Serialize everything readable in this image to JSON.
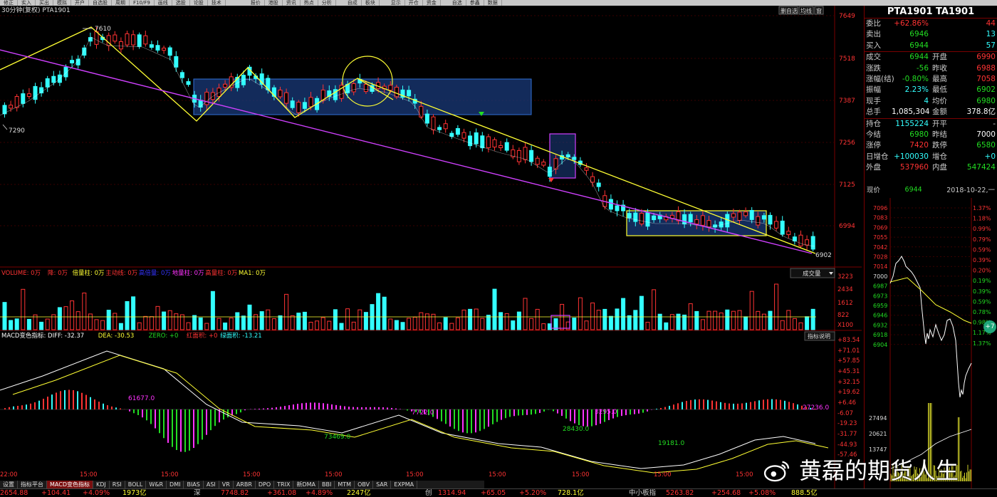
{
  "topbar": {
    "items": [
      "修正",
      "实入",
      "买出",
      "模拟",
      "开户",
      "自选股",
      "周期",
      "F10/F9",
      "画线",
      "选股",
      "论股",
      "技术",
      "",
      "报价",
      "港股",
      "资讯",
      "热点",
      "分析",
      "",
      "自成",
      "板块",
      "",
      "显示",
      "开仓",
      "资金",
      "",
      "自选",
      "参鑫",
      "数据"
    ],
    "active_index": 12
  },
  "chart": {
    "header_title": "30分钟(复权)  PTA1901",
    "header_buttons": [
      "删自选",
      "均线",
      "窗"
    ],
    "price_axis": [
      "7649",
      "7518",
      "7387",
      "7256",
      "7125",
      "6994"
    ],
    "high_label": "7610",
    "low_label": "7290",
    "last_label": "6902",
    "volume_header": [
      {
        "text": "VOLUME: 0万",
        "color": "#ff3333"
      },
      {
        "text": "降: 0万",
        "color": "#ff3333"
      },
      {
        "text": "倍量柱: 0万",
        "color": "#ffff33"
      },
      {
        "text": "主动线: 0万",
        "color": "#ff3333"
      },
      {
        "text": "高倍量: 0万",
        "color": "#3333ff"
      },
      {
        "text": "地量柱: 0万",
        "color": "#ff33ff"
      },
      {
        "text": "高量柱: 0万",
        "color": "#ff3333"
      },
      {
        "text": "MA1: 0万",
        "color": "#ffff33"
      }
    ],
    "volume_button": "成交量",
    "volume_axis": [
      "3223",
      "2434",
      "1612",
      "822",
      "X100"
    ],
    "macd_header": [
      {
        "text": "MACD变色指标: DIFF: -32.37",
        "color": "#ffffff"
      },
      {
        "text": "DEA: -30.53",
        "color": "#ffff33"
      },
      {
        "text": "ZERO: +0",
        "color": "#22dd22"
      },
      {
        "text": "红面积: +0",
        "color": "#ff3333"
      },
      {
        "text": "绿面积: -13.21",
        "color": "#33ffff"
      }
    ],
    "macd_button": "指标说明",
    "macd_axis": [
      "+83.54",
      "+71.01",
      "+57.85",
      "+45.31",
      "+32.15",
      "+19.62",
      "+6.46",
      "-6.07",
      "-19.23",
      "-31.77",
      "-44.93",
      "-57.46"
    ],
    "macd_annotations": [
      "61677.0",
      "73469.0",
      "7722.0",
      "28430.0",
      "3295.0",
      "19181.0",
      "27236.0"
    ],
    "time_labels": [
      "22:00",
      "15:00",
      "15:00",
      "15:00",
      "15:00",
      "15:00",
      "15:00",
      "15:00",
      "15:00",
      "15:00"
    ]
  },
  "tabs": [
    "设置",
    "指标平台",
    "MACD变色指标",
    "KDJ",
    "RSI",
    "BOLL",
    "W&R",
    "DMI",
    "BIAS",
    "ASI",
    "VR",
    "ARBR",
    "DPO",
    "TRIX",
    "新DMA",
    "BBI",
    "MTM",
    "OBV",
    "SAR",
    "EXPMA"
  ],
  "tabs_active": 2,
  "quote": {
    "title": "PTA1901 TA1901",
    "rows1": [
      {
        "l": "委比",
        "v": "+62.86%",
        "vc": "#ff3333",
        "l2": "",
        "v2": "44",
        "v2c": "#ff3333"
      },
      {
        "l": "卖出",
        "v": "6946",
        "vc": "#22dd22",
        "l2": "",
        "v2": "13",
        "v2c": "#33ffff"
      },
      {
        "l": "买入",
        "v": "6944",
        "vc": "#22dd22",
        "l2": "",
        "v2": "57",
        "v2c": "#33ffff"
      }
    ],
    "rows2": [
      {
        "l": "成交",
        "v": "6944",
        "vc": "#22dd22",
        "l2": "开盘",
        "v2": "6990",
        "v2c": "#ff3333"
      },
      {
        "l": "涨跌",
        "v": "-56",
        "vc": "#22dd22",
        "l2": "昨收",
        "v2": "6988",
        "v2c": "#ff3333"
      },
      {
        "l": "涨幅(结)",
        "v": "-0.80%",
        "vc": "#22dd22",
        "l2": "最高",
        "v2": "7058",
        "v2c": "#ff3333"
      },
      {
        "l": "振幅",
        "v": "2.23%",
        "vc": "#33ffff",
        "l2": "最低",
        "v2": "6902",
        "v2c": "#22dd22"
      },
      {
        "l": "现手",
        "v": "4",
        "vc": "#33ffff",
        "l2": "均价",
        "v2": "6980",
        "v2c": "#22dd22"
      },
      {
        "l": "总手",
        "v": "1,085,304",
        "vc": "#ffffff",
        "l2": "金额",
        "v2": "378.8亿",
        "v2c": "#ffffff"
      }
    ],
    "rows3": [
      {
        "l": "持仓",
        "v": "1155224",
        "vc": "#33ffff",
        "l2": "开平",
        "v2": "-",
        "v2c": "#cccccc"
      },
      {
        "l": "今结",
        "v": "6980",
        "vc": "#22dd22",
        "l2": "昨结",
        "v2": "7000",
        "v2c": "#ffffff"
      },
      {
        "l": "涨停",
        "v": "7420",
        "vc": "#ff3333",
        "l2": "跌停",
        "v2": "6580",
        "v2c": "#22dd22"
      },
      {
        "l": "日增仓",
        "v": "+100030",
        "vc": "#33ffff",
        "l2": "增仓",
        "v2": "+0",
        "v2c": "#33ffff"
      },
      {
        "l": "外盘",
        "v": "537960",
        "vc": "#ff3333",
        "l2": "内盘",
        "v2": "547424",
        "v2c": "#22dd22"
      }
    ],
    "current_label": "现价",
    "current_value": "6944",
    "date": "2018-10-22,一",
    "time_axis_left": [
      "7096",
      "7083",
      "7069",
      "7055",
      "7042",
      "7028",
      "7014",
      "7000",
      "6987",
      "6973",
      "6959",
      "6946",
      "6932",
      "6918",
      "6904",
      "27494",
      "20621",
      "13747"
    ],
    "time_axis_right": [
      "1.37%",
      "1.18%",
      "0.99%",
      "0.79%",
      "0.59%",
      "0.39%",
      "0.20%",
      "0.19%",
      "0.39%",
      "0.59%",
      "0.78%",
      "0.98%",
      "1.17%",
      "1.37%"
    ]
  },
  "bottombar": [
    {
      "t": "2654.88",
      "c": "#ff3333"
    },
    {
      "t": "+104.41",
      "c": "#ff3333"
    },
    {
      "t": "+4.09%",
      "c": "#ff3333"
    },
    {
      "t": "1973亿",
      "c": "#ffff33"
    },
    {
      "t": "深",
      "c": "#ccc"
    },
    {
      "t": "7748.82",
      "c": "#ff3333"
    },
    {
      "t": "+361.08",
      "c": "#ff3333"
    },
    {
      "t": "+4.89%",
      "c": "#ff3333"
    },
    {
      "t": "2247亿",
      "c": "#ffff33"
    },
    {
      "t": "创",
      "c": "#ccc"
    },
    {
      "t": "1314.94",
      "c": "#ff3333"
    },
    {
      "t": "+65.05",
      "c": "#ff3333"
    },
    {
      "t": "+5.20%",
      "c": "#ff3333"
    },
    {
      "t": "728.1亿",
      "c": "#ffff33"
    },
    {
      "t": "中小板指",
      "c": "#ccc"
    },
    {
      "t": "5263.82",
      "c": "#ff3333"
    },
    {
      "t": "+254.68",
      "c": "#ff3333"
    },
    {
      "t": "+5.08%",
      "c": "#ff3333"
    },
    {
      "t": "888.5亿",
      "c": "#ffff33"
    }
  ],
  "watermark": "黄磊的期货人生",
  "badge": "+7"
}
